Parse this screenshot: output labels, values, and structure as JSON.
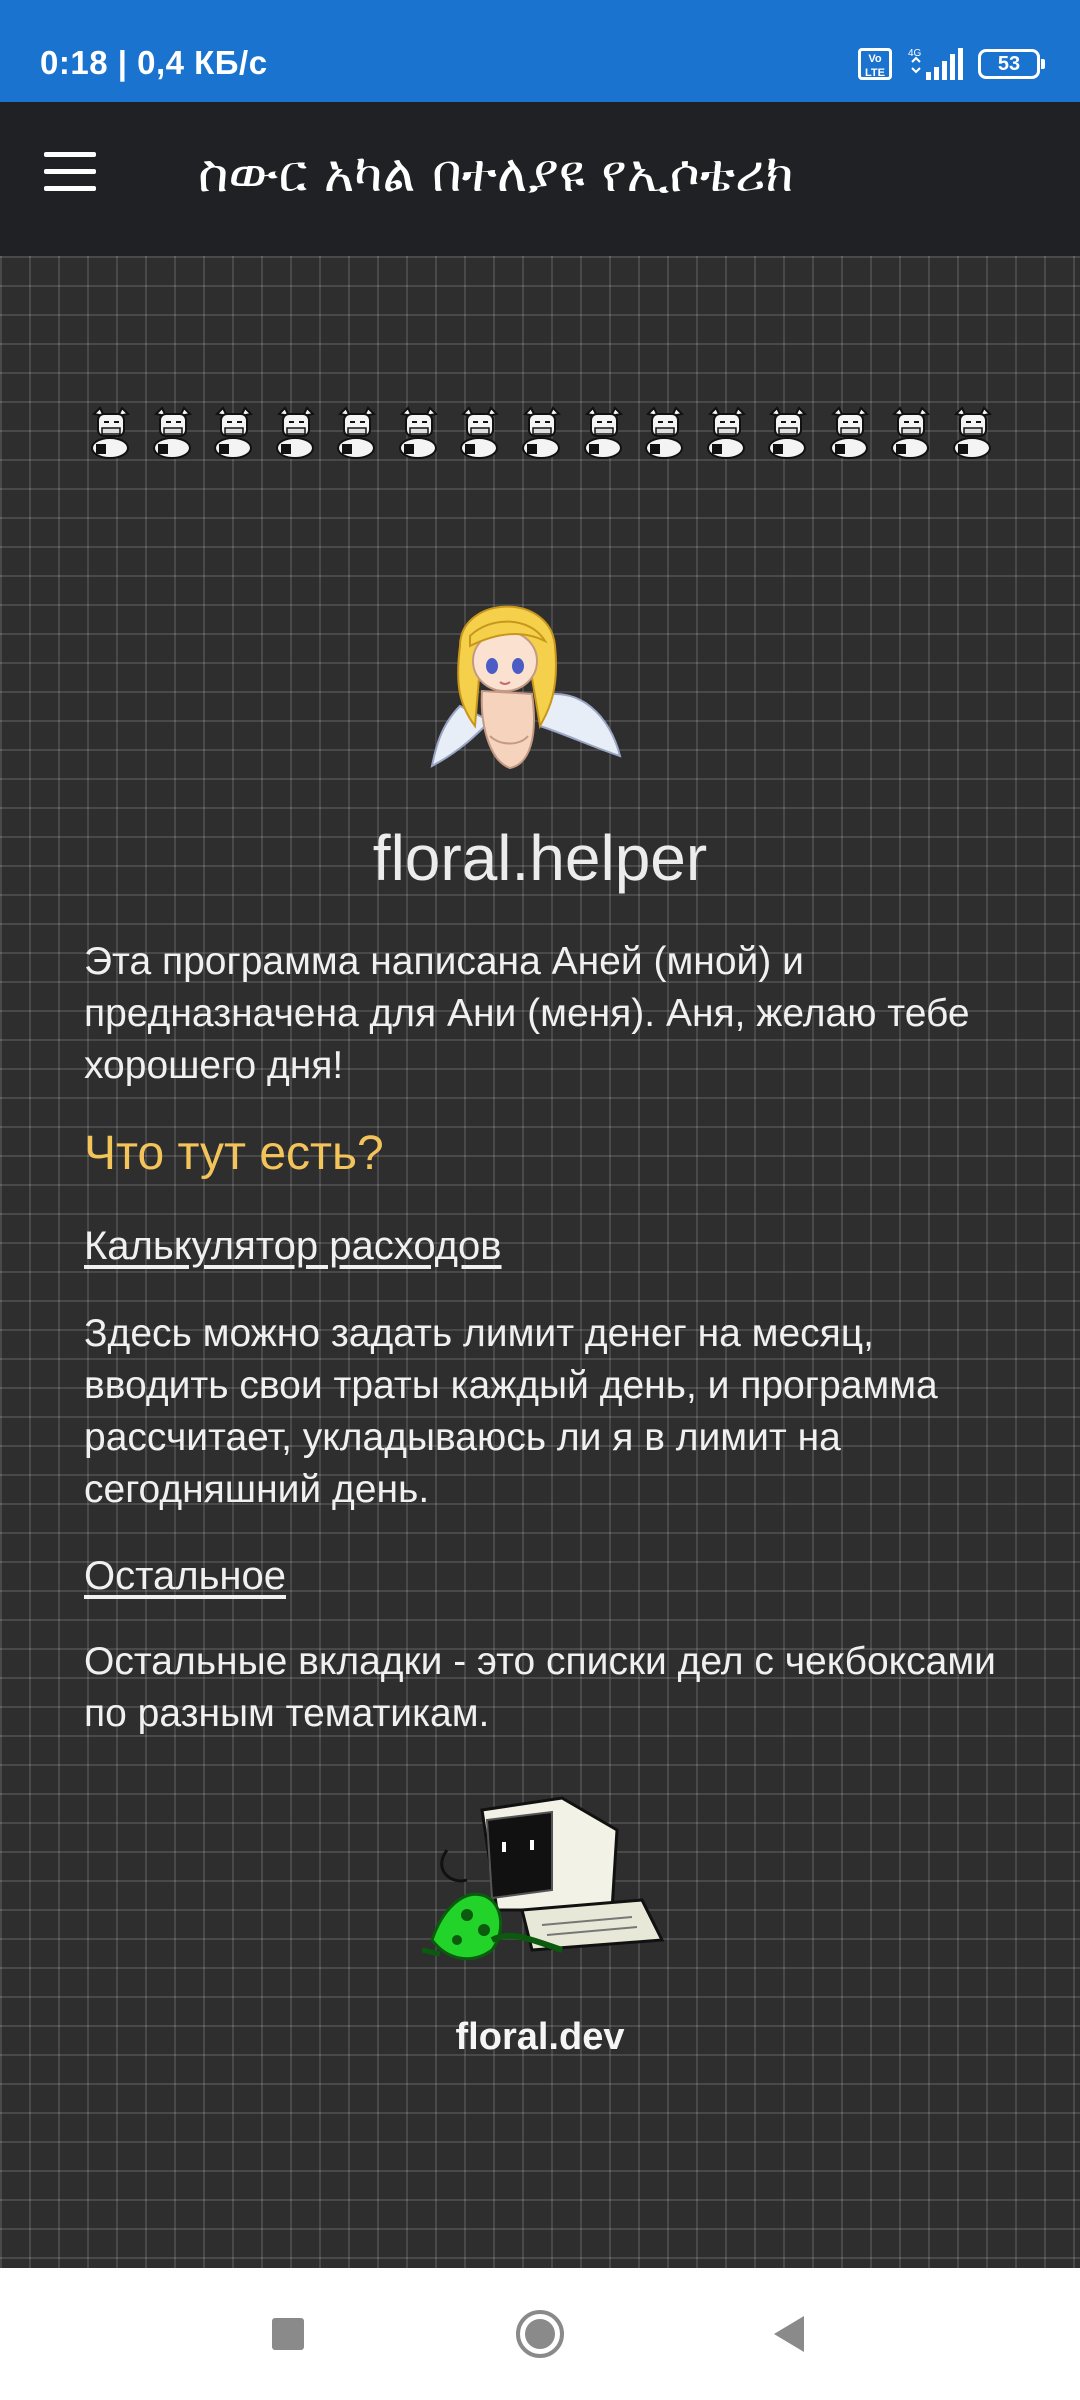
{
  "status_bar": {
    "time_speed": "0:18 | 0,4 КБ/с",
    "volte": "Vo LTE",
    "network": "4G",
    "battery": "53"
  },
  "app_bar": {
    "title": "ስውር አካል በተለያዩ የኢሶቴሪክ"
  },
  "main": {
    "heading": "floral.helper",
    "intro": "Эта программа написана Аней (мной) и предназначена для Ани (меня). Аня, желаю тебе хорошего дня!",
    "section_title": "Что тут есть?",
    "calculator_link": "Калькулятор расходов",
    "calculator_text": "Здесь можно задать лимит денег на месяц, вводить свои траты каждый день, и программа рассчитает, укладываюсь ли я в лимит на сегодняшний день.",
    "other_link": "Остальное",
    "other_text": "Остальные вкладки - это списки дел с чекбоксами по разным тематикам.",
    "footer_label": "floral.dev"
  },
  "icons": {
    "menu": "menu-icon",
    "cow": "cow-sprite-icon",
    "angel": "angel-sprite",
    "computer": "computer-frog-sprite",
    "nav_recent": "square-icon",
    "nav_home": "circle-icon",
    "nav_back": "triangle-back-icon"
  },
  "colors": {
    "status_bar": "#1a73cf",
    "app_bar": "#1f2124",
    "background": "#2e2e2e",
    "accent_heading": "#f3c45a",
    "text": "#f0f0f0"
  }
}
